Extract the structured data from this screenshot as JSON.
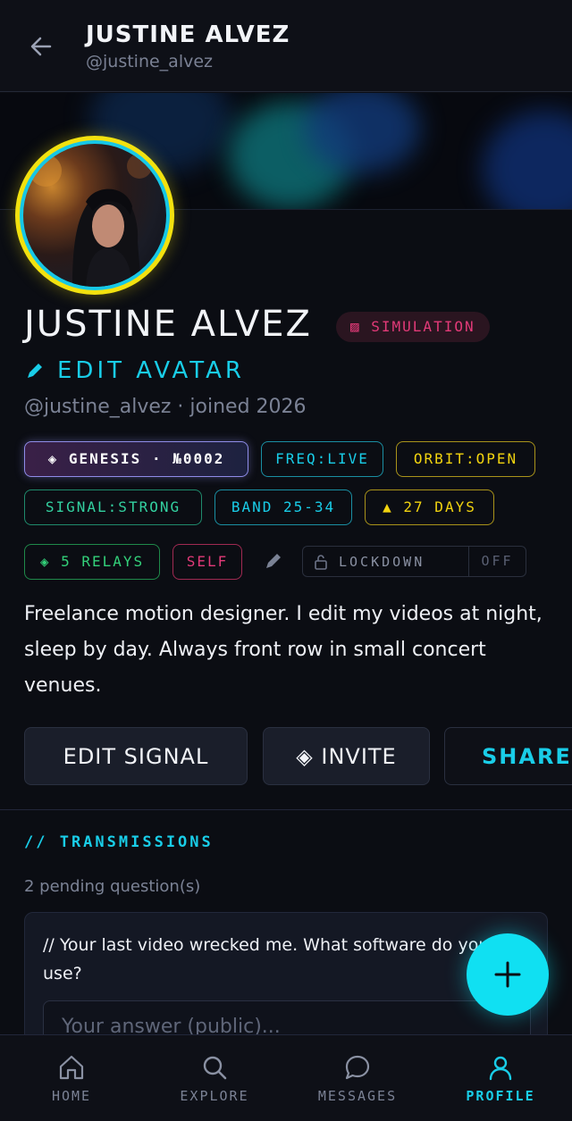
{
  "header": {
    "name": "JUSTINE ALVEZ",
    "handle": "@justine_alvez"
  },
  "profile": {
    "name": "JUSTINE ALVEZ",
    "simulation_badge": "▨ SIMULATION",
    "edit_avatar": "EDIT AVATAR",
    "meta": "@justine_alvez · joined 2026",
    "chips": {
      "genesis": "◈ GENESIS · №0002",
      "freq": "FREQ:LIVE",
      "orbit": "ORBIT:OPEN",
      "signal": "SIGNAL:STRONG",
      "band": "BAND 25-34",
      "days": "▲ 27 DAYS",
      "relays": "◈ 5 RELAYS",
      "self": "SELF"
    },
    "lockdown": {
      "label": "LOCKDOWN",
      "state": "OFF"
    },
    "bio": "Freelance motion designer. I edit my videos at night, sleep by day. Always front row in small concert venues."
  },
  "actions": {
    "edit_signal": "EDIT SIGNAL",
    "invite": "◈ INVITE",
    "share": "SHARE"
  },
  "transmissions": {
    "title": "// TRANSMISSIONS",
    "pending": "2 pending question(s)",
    "question": "// Your last video wrecked me. What software do you use?",
    "answer_placeholder": "Your answer (public)..."
  },
  "nav": {
    "home": "HOME",
    "explore": "EXPLORE",
    "messages": "MESSAGES",
    "profile": "PROFILE"
  },
  "colors": {
    "accent_cyan": "#19cde8",
    "accent_yellow": "#f2e10f",
    "accent_pink": "#e23a78",
    "accent_green": "#33d17a"
  }
}
